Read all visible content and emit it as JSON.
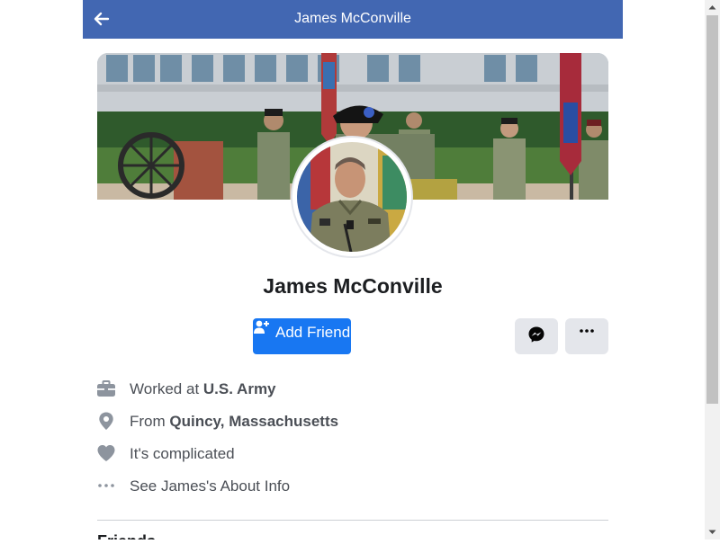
{
  "topbar": {
    "title": "James McConville",
    "back_icon": "arrow-left-icon"
  },
  "profile": {
    "name": "James McConville",
    "cover_photo": "ceremony-cover-photo",
    "avatar": "profile-photo"
  },
  "actions": {
    "add_friend_label": "Add Friend",
    "add_friend_icon": "person-add-icon",
    "messenger_icon": "messenger-icon",
    "more_icon": "more-horizontal-icon"
  },
  "info": {
    "work_prefix": "Worked at ",
    "work_value": "U.S. Army",
    "hometown_prefix": "From ",
    "hometown_value": "Quincy, Massachusetts",
    "relationship": "It's complicated",
    "about_link": "See James's About Info"
  },
  "sections": {
    "friends_heading": "Friends"
  },
  "colors": {
    "header_blue": "#4267b2",
    "primary_button": "#1877f2",
    "secondary_button": "#e4e6eb",
    "icon_gray": "#8d949e"
  }
}
